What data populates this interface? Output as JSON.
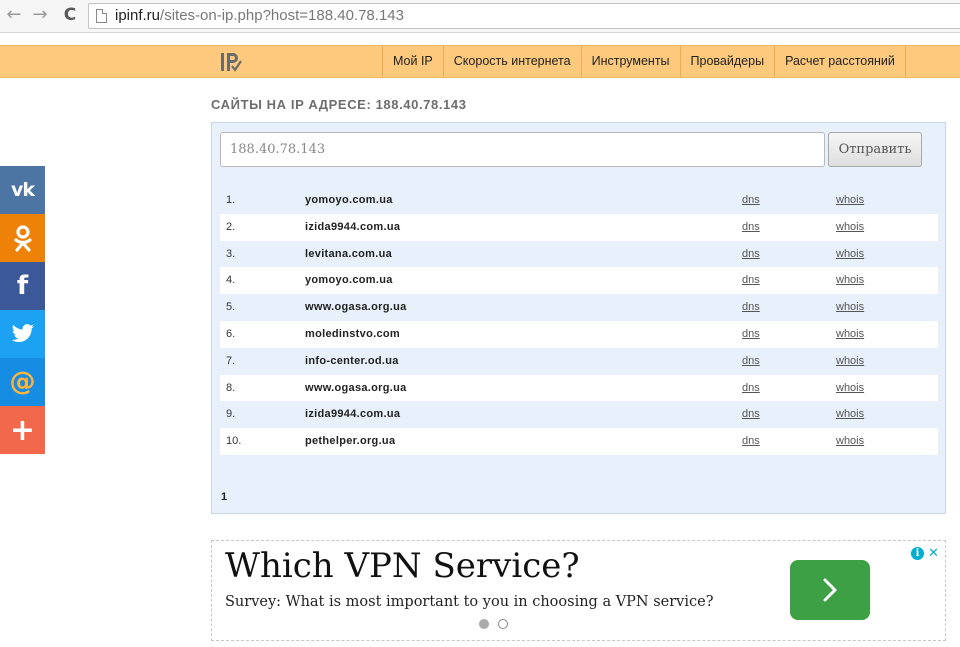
{
  "browser": {
    "url_host": "ipinf.ru",
    "url_path": "/sites-on-ip.php?host=188.40.78.143"
  },
  "header": {
    "menu": [
      {
        "label": "Мой IP"
      },
      {
        "label": "Скорость интернета"
      },
      {
        "label": "Инструменты"
      },
      {
        "label": "Провайдеры"
      },
      {
        "label": "Расчет расстояний"
      }
    ]
  },
  "main": {
    "title": "САЙТЫ НА IP АДРЕСЕ: 188.40.78.143",
    "input_placeholder": "188.40.78.143",
    "submit_label": "Отправить",
    "rows": [
      {
        "num": "1.",
        "domain": "yomoyo.com.ua",
        "dns": "dns",
        "whois": "whois"
      },
      {
        "num": "2.",
        "domain": "izida9944.com.ua",
        "dns": "dns",
        "whois": "whois"
      },
      {
        "num": "3.",
        "domain": "levitana.com.ua",
        "dns": "dns",
        "whois": "whois"
      },
      {
        "num": "4.",
        "domain": "yomoyo.com.ua",
        "dns": "dns",
        "whois": "whois"
      },
      {
        "num": "5.",
        "domain": "www.ogasa.org.ua",
        "dns": "dns",
        "whois": "whois"
      },
      {
        "num": "6.",
        "domain": "moledinstvo.com",
        "dns": "dns",
        "whois": "whois"
      },
      {
        "num": "7.",
        "domain": "info-center.od.ua",
        "dns": "dns",
        "whois": "whois"
      },
      {
        "num": "8.",
        "domain": "www.ogasa.org.ua",
        "dns": "dns",
        "whois": "whois"
      },
      {
        "num": "9.",
        "domain": "izida9944.com.ua",
        "dns": "dns",
        "whois": "whois"
      },
      {
        "num": "10.",
        "domain": "pethelper.org.ua",
        "dns": "dns",
        "whois": "whois"
      }
    ],
    "pager": "1"
  },
  "social": {
    "vk": "vk",
    "facebook": "f",
    "mail": "@",
    "more": "+"
  },
  "ad": {
    "title": "Which VPN Service?",
    "text": "Survey: What is most important to you in choosing a VPN service?",
    "info": "i",
    "close": "✕"
  },
  "colors": {
    "header_bg": "#fcc97d",
    "panel_bg": "#e8f0fb",
    "vk": "#4c75a3",
    "ok": "#ee8208",
    "facebook": "#3b5998",
    "twitter": "#1da1f2",
    "mail": "#168de2",
    "share": "#f2684a",
    "ad_button": "#3ea044"
  }
}
